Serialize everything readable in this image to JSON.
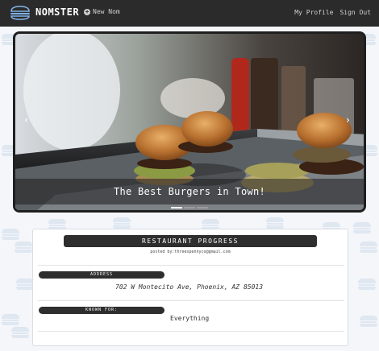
{
  "navbar": {
    "brand": "NOMSTER",
    "new_nom": "New Nom",
    "links": [
      "My Profile",
      "Sign Out"
    ]
  },
  "carousel": {
    "caption": "The Best Burgers in Town!",
    "slide_count": 3,
    "active_slide": 1
  },
  "restaurant": {
    "name": "RESTAURANT PROGRESS",
    "posted_by": "posted by:threexpennyco@gmail.com",
    "address_label": "ADDRESS",
    "address": "702 W Montecito Ave, Phoenix, AZ 85013",
    "known_for_label": "KNOWN FOR:",
    "known_for": "Everything"
  },
  "colors": {
    "navbar_bg": "#2b2b2b",
    "label_bg": "#2e2e2e",
    "page_bg": "#f4f6fa"
  },
  "icons": [
    "burger-logo-icon",
    "plus-circle-icon",
    "chevron-left-icon",
    "chevron-right-icon"
  ]
}
